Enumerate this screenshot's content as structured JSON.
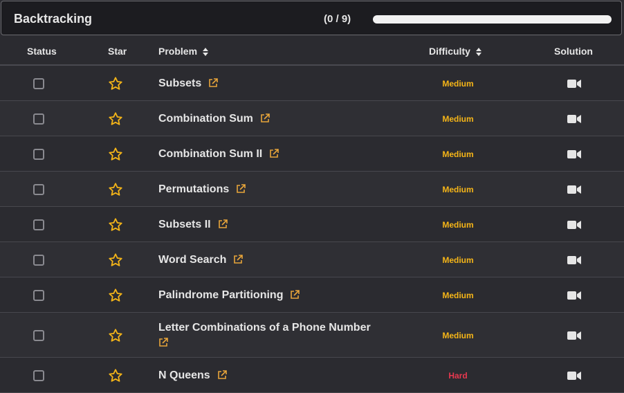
{
  "header": {
    "title": "Backtracking",
    "progress_text": "(0 / 9)",
    "progress_fraction": 0
  },
  "table": {
    "columns": {
      "status": "Status",
      "star": "Star",
      "problem": "Problem",
      "difficulty": "Difficulty",
      "solution": "Solution"
    },
    "rows": [
      {
        "problem": "Subsets",
        "difficulty": "Medium"
      },
      {
        "problem": "Combination Sum",
        "difficulty": "Medium"
      },
      {
        "problem": "Combination Sum II",
        "difficulty": "Medium"
      },
      {
        "problem": "Permutations",
        "difficulty": "Medium"
      },
      {
        "problem": "Subsets II",
        "difficulty": "Medium"
      },
      {
        "problem": "Word Search",
        "difficulty": "Medium"
      },
      {
        "problem": "Palindrome Partitioning",
        "difficulty": "Medium"
      },
      {
        "problem": "Letter Combinations of a Phone Number",
        "difficulty": "Medium"
      },
      {
        "problem": "N Queens",
        "difficulty": "Hard"
      }
    ]
  },
  "colors": {
    "medium": "#f5b518",
    "hard": "#e8384f",
    "star": "#f5b518",
    "link": "#e8a53a",
    "progress_fill": "#2bb673"
  },
  "icons": {
    "star": "star-icon",
    "external": "external-link-icon",
    "solution": "video-icon",
    "sort": "sort-icon"
  }
}
